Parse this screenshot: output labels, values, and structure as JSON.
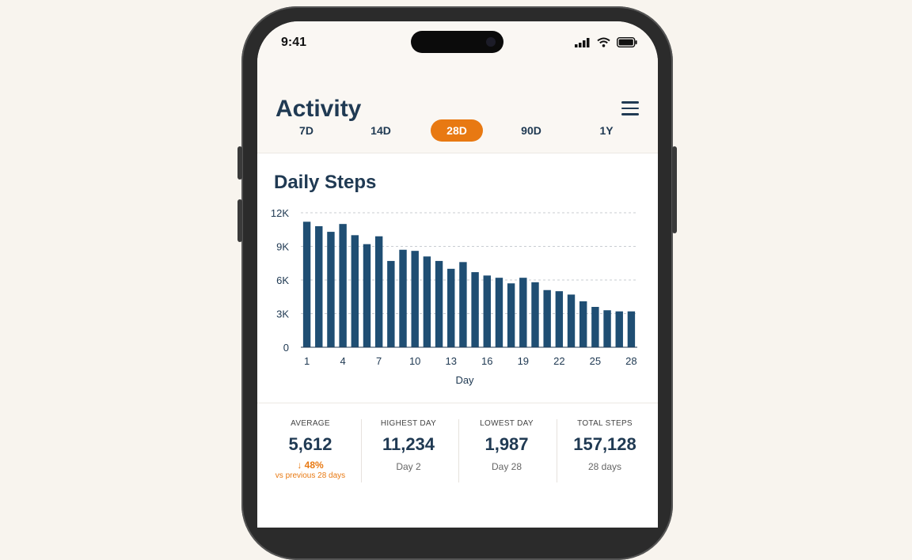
{
  "status": {
    "time": "9:41"
  },
  "header": {
    "title": "Activity"
  },
  "tabs": [
    {
      "label": "7D",
      "active": false
    },
    {
      "label": "14D",
      "active": false
    },
    {
      "label": "28D",
      "active": true
    },
    {
      "label": "90D",
      "active": false
    },
    {
      "label": "1Y",
      "active": false
    }
  ],
  "colors": {
    "accent": "#e87912",
    "bar": "#1f4e73",
    "text": "#203a53"
  },
  "chart_data": {
    "type": "bar",
    "title": "Daily Steps",
    "xlabel": "Day",
    "ylabel": "",
    "ylim": [
      0,
      12000
    ],
    "yticks": [
      {
        "value": 0,
        "label": "0"
      },
      {
        "value": 3000,
        "label": "3K"
      },
      {
        "value": 6000,
        "label": "6K"
      },
      {
        "value": 9000,
        "label": "9K"
      },
      {
        "value": 12000,
        "label": "12K"
      }
    ],
    "xticks": [
      1,
      4,
      7,
      10,
      13,
      16,
      19,
      22,
      25,
      28
    ],
    "grid": true,
    "categories": [
      1,
      2,
      3,
      4,
      5,
      6,
      7,
      8,
      9,
      10,
      11,
      12,
      13,
      14,
      15,
      16,
      17,
      18,
      19,
      20,
      21,
      22,
      23,
      24,
      25,
      26,
      27,
      28
    ],
    "values": [
      11200,
      10800,
      10300,
      11000,
      10000,
      9200,
      9900,
      7700,
      8700,
      8600,
      8100,
      7700,
      7000,
      7600,
      6700,
      6400,
      6200,
      5700,
      6200,
      5800,
      5100,
      5000,
      4700,
      4100,
      3600,
      3300,
      3200,
      3200
    ]
  },
  "stats": [
    {
      "label": "AVERAGE",
      "value": "5,612",
      "delta": "48%",
      "compare": "vs previous 28 days"
    },
    {
      "label": "HIGHEST DAY",
      "value": "11,234",
      "sub": "Day 2"
    },
    {
      "label": "LOWEST DAY",
      "value": "1,987",
      "sub": "Day 28"
    },
    {
      "label": "TOTAL STEPS",
      "value": "157,128",
      "sub": "28 days"
    }
  ]
}
